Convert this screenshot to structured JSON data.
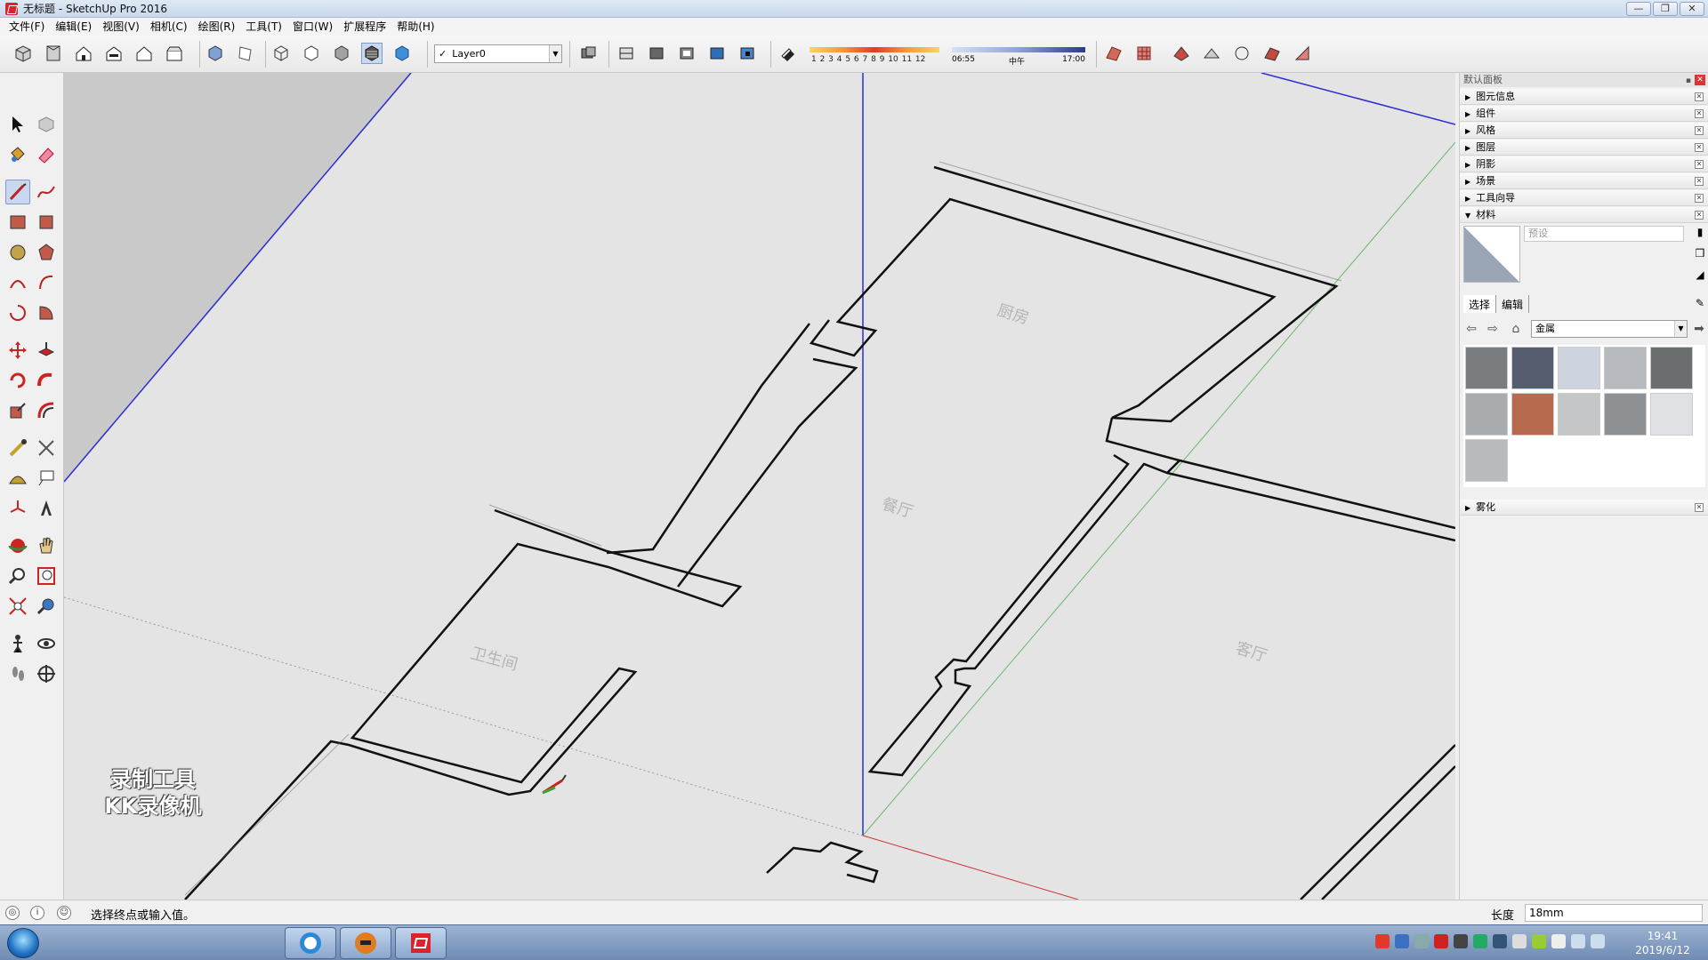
{
  "window": {
    "title": "无标题 - SketchUp Pro 2016"
  },
  "menu": [
    "文件(F)",
    "编辑(E)",
    "视图(V)",
    "相机(C)",
    "绘图(R)",
    "工具(T)",
    "窗口(W)",
    "扩展程序",
    "帮助(H)"
  ],
  "toolbar": {
    "layer": "Layer0",
    "shadow_months": "1 2 3 4 5 6 7 8 9 10 11 12",
    "shadow_time_start": "06:55",
    "shadow_time_mid": "中午",
    "shadow_time_end": "17:00"
  },
  "viewport": {
    "room_labels": [
      "厨房",
      "餐厅",
      "卫生间",
      "客厅"
    ],
    "watermark_line1": "录制工具",
    "watermark_line2": "KK录像机"
  },
  "right_panel": {
    "title": "默认面板",
    "trays": [
      {
        "label": "图元信息",
        "expanded": false
      },
      {
        "label": "组件",
        "expanded": false
      },
      {
        "label": "风格",
        "expanded": false
      },
      {
        "label": "图层",
        "expanded": false
      },
      {
        "label": "阴影",
        "expanded": false
      },
      {
        "label": "场景",
        "expanded": false
      },
      {
        "label": "工具向导",
        "expanded": false
      },
      {
        "label": "材料",
        "expanded": true
      }
    ],
    "materials": {
      "name_placeholder": "预设",
      "tab_select": "选择",
      "tab_edit": "编辑",
      "category": "金属",
      "swatch_colors": [
        "#7a7d80",
        "#565d6e",
        "#cdd4e0",
        "#b6b9bd",
        "#6a6e6e",
        "#a9acae",
        "#b86a4e",
        "#c4c6c8",
        "#8e9194",
        "#dfe1e4",
        "#b8babb"
      ]
    },
    "fog_tray": "雾化"
  },
  "status": {
    "message": "选择终点或输入值。",
    "vcb_label": "长度",
    "vcb_value": "18mm"
  },
  "taskbar": {
    "time": "19:41",
    "date": "2019/6/12"
  }
}
